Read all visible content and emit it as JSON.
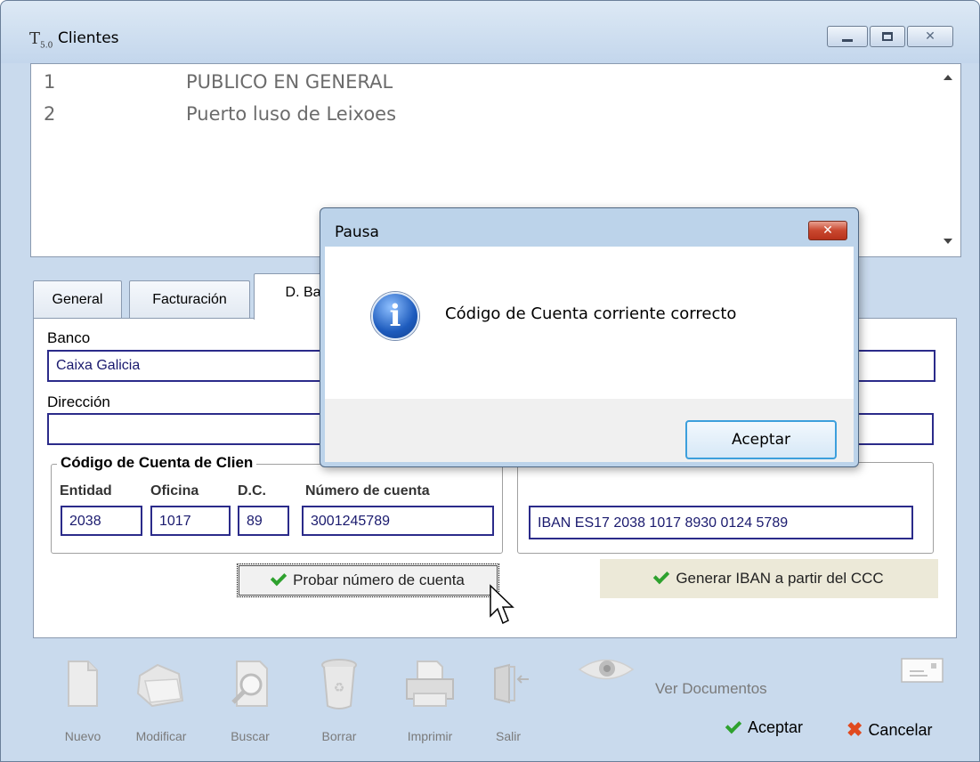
{
  "window": {
    "title": "Clientes",
    "app_icon_text": "T",
    "app_icon_sub": "5.0"
  },
  "clients": [
    {
      "id": "1",
      "name": "PUBLICO EN GENERAL"
    },
    {
      "id": "2",
      "name": "Puerto luso de Leixoes"
    }
  ],
  "tabs": {
    "general": "General",
    "facturacion": "Facturación",
    "d_bancarios": "D. Ban"
  },
  "form": {
    "banco_label": "Banco",
    "banco_value": "Caixa Galicia",
    "direccion_label": "Dirección",
    "direccion_value": "",
    "group_caption": "Código de Cuenta de Clien",
    "entidad_label": "Entidad",
    "oficina_label": "Oficina",
    "dc_label": "D.C.",
    "numero_label": "Número de cuenta",
    "entidad_value": "2038",
    "oficina_value": "1017",
    "dc_value": "89",
    "numero_value": "3001245789",
    "iban_value": "IBAN ES17 2038 1017 8930 0124 5789",
    "probar_button": "Probar número de cuenta",
    "generar_iban_button": "Generar IBAN a partir del CCC"
  },
  "toolbar": {
    "nuevo": "Nuevo",
    "modificar": "Modificar",
    "buscar": "Buscar",
    "borrar": "Borrar",
    "imprimir": "Imprimir",
    "salir": "Salir",
    "ver_documentos": "Ver Documentos",
    "aceptar": "Aceptar",
    "cancelar": "Cancelar"
  },
  "dialog": {
    "title": "Pausa",
    "message": "Código de Cuenta corriente correcto",
    "ok_button": "Aceptar",
    "close_glyph": "✕"
  },
  "icons": [
    "app-icon",
    "minimize-icon",
    "maximize-icon",
    "close-icon",
    "info-icon",
    "check-icon",
    "cancel-x-icon",
    "new-document-icon",
    "folder-icon",
    "search-document-icon",
    "trash-icon",
    "printer-icon",
    "exit-door-icon",
    "eye-icon",
    "keyboard-icon",
    "mouse-cursor-icon"
  ],
  "colors": {
    "window_frame": "#c9daed",
    "field_border": "#2b2b8a",
    "check_green": "#2ea12e",
    "cancel_red": "#e04a1f",
    "dialog_close_red": "#c9472e",
    "ok_focus_blue": "#3c9fdc"
  }
}
